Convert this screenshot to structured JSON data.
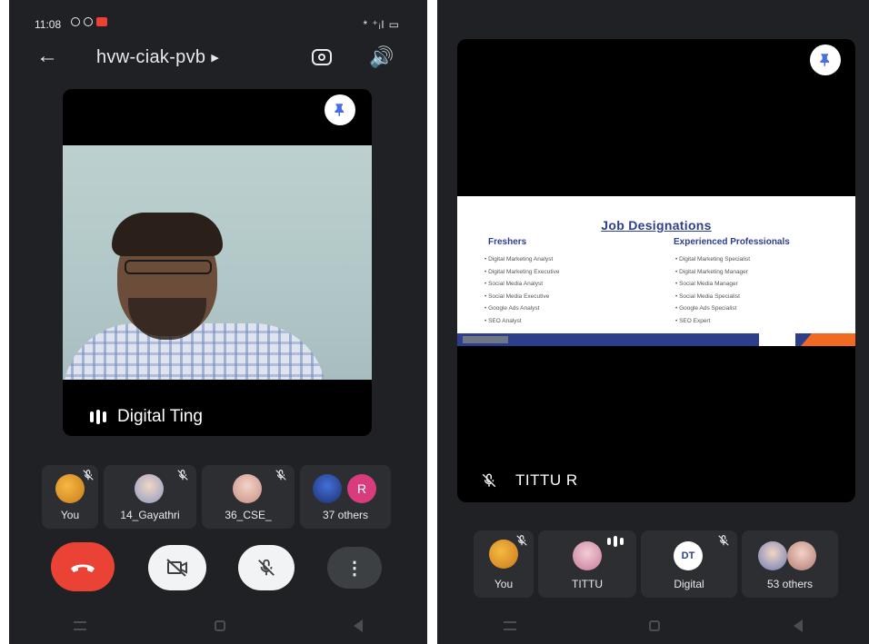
{
  "left": {
    "status": {
      "time": "11:08",
      "right": "* ⁺ᵢl ▭"
    },
    "header": {
      "back": "←",
      "title": "hvw-ciak-pvb",
      "caret": "▶",
      "speaker": "🔊"
    },
    "main_tile": {
      "name": "Digital Ting"
    },
    "participants": [
      {
        "label": "You"
      },
      {
        "label": "14_Gayathri"
      },
      {
        "label": "36_CSE_"
      },
      {
        "label": "37 others",
        "badge": "R"
      }
    ],
    "more": "⋮"
  },
  "right": {
    "share_tile": {
      "name": "TITTU R",
      "slide": {
        "title": "Job Designations",
        "freshers_head": "Freshers",
        "freshers": [
          "• Digital Marketing Analyst",
          "• Digital Marketing Executive",
          "• Social Media Analyst",
          "• Social Media Executive",
          "• Google Ads Analyst",
          "• SEO Analyst"
        ],
        "experienced_head": "Experienced Professionals",
        "experienced": [
          "• Digital Marketing Specialist",
          "• Digital Marketing Manager",
          "• Social Media Manager",
          "• Social Media Specialist",
          "• Google Ads Specialist",
          "• SEO Expert"
        ]
      }
    },
    "participants": [
      {
        "label": "You"
      },
      {
        "label": "TITTU"
      },
      {
        "label": "Digital"
      },
      {
        "label": "53 others"
      }
    ]
  },
  "colors": {
    "end_call": "#ea4335",
    "background": "#202124",
    "tile": "#2d2e31",
    "pin": "#4a6ee0",
    "avatar_r": "#d93c7c"
  }
}
